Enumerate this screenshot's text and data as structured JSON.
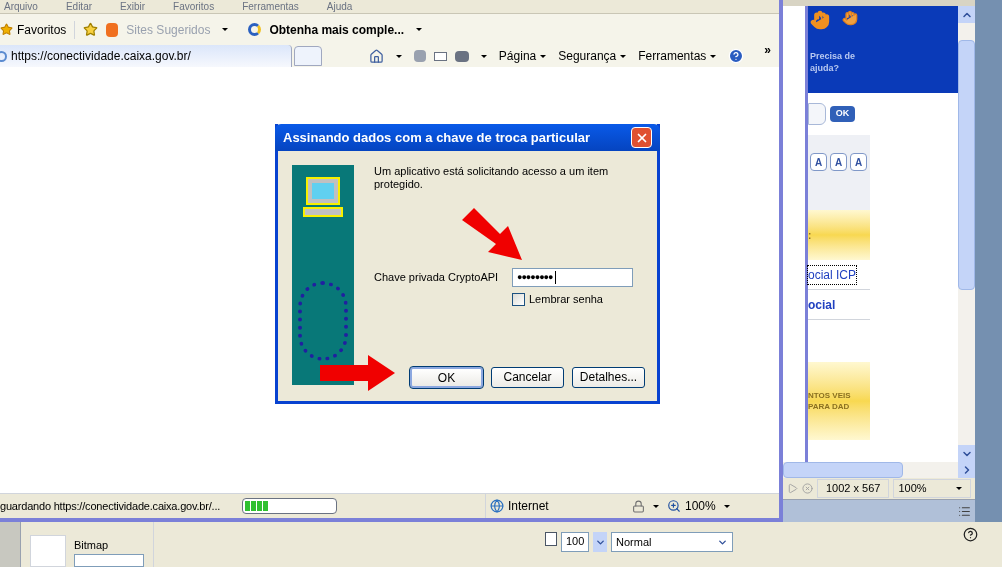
{
  "browser": {
    "menu": [
      "Arquivo",
      "Editar",
      "Exibir",
      "Favoritos",
      "Ferramentas",
      "Ajuda"
    ],
    "favorites_bar": {
      "favorites": "Favoritos",
      "suggested": "Sites Sugeridos",
      "tab": "Obtenha mais comple..."
    },
    "address": "https://conectividade.caixa.gov.br/",
    "commands": [
      "Página",
      "Segurança",
      "Ferramentas"
    ],
    "overflow": "»",
    "status_bar": {
      "text": "guardando https://conectividade.caixa.gov.br/...",
      "level": 0.27,
      "zone": "Internet",
      "zoom": "100%"
    }
  },
  "dialog": {
    "title": "Assinando dados com a chave de troca particular",
    "message": "Um aplicativo está solicitando acesso a um item protegido.",
    "field_label": "Chave privada CryptoAPI",
    "password": "●●●●●●●●",
    "remember": {
      "label": "Lembrar senha",
      "checked": false
    },
    "buttons": [
      {
        "label": "OK",
        "default": true
      },
      {
        "label": "Cancelar",
        "default": false
      },
      {
        "label": "Detalhes...",
        "default": false
      }
    ]
  },
  "side_window": {
    "help": "Precisa de ajuda?",
    "search_button": "OK",
    "font_buttons": [
      "A",
      "A",
      "A"
    ],
    "band_1": ":",
    "links": [
      {
        "label": "ocial ICP",
        "focused": true
      },
      {
        "label": "ocial",
        "focused": false
      }
    ],
    "band_2": "NTOS VEIS PARA DAD",
    "size": "1002 x 567",
    "zoom": "100%"
  },
  "panel": {
    "layer": "Bitmap",
    "opacity": "100",
    "blend": "Normal"
  }
}
